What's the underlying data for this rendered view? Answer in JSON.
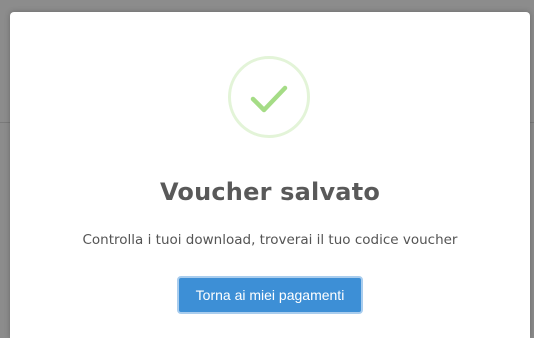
{
  "dialog": {
    "icon": "checkmark-success-icon",
    "title": "Voucher salvato",
    "message": "Controlla i tuoi download, troverai il tuo codice voucher",
    "button_label": "Torna ai miei pagamenti"
  },
  "colors": {
    "success_green": "#a5dc86",
    "success_ring": "#e3f4d8",
    "button_blue": "#3d8fd6",
    "title_gray": "#595959"
  }
}
